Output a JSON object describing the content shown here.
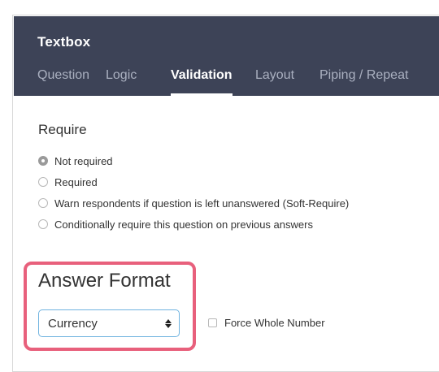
{
  "panel": {
    "title": "Textbox"
  },
  "tabs": [
    {
      "label": "Question",
      "active": false
    },
    {
      "label": "Logic",
      "active": false
    },
    {
      "label": "Validation",
      "active": true
    },
    {
      "label": "Layout",
      "active": false
    },
    {
      "label": "Piping / Repeat",
      "active": false
    }
  ],
  "require": {
    "heading": "Require",
    "options": [
      {
        "label": "Not required",
        "checked": true
      },
      {
        "label": "Required",
        "checked": false
      },
      {
        "label": "Warn respondents if question is left unanswered (Soft-Require)",
        "checked": false
      },
      {
        "label": "Conditionally require this question on previous answers",
        "checked": false
      }
    ]
  },
  "answer_format": {
    "heading": "Answer Format",
    "select_value": "Currency",
    "checkbox_label": "Force Whole Number",
    "checkbox_checked": false
  },
  "colors": {
    "header_bg": "#3d4357",
    "highlight": "#e8607c",
    "select_border": "#6fb3e0"
  }
}
